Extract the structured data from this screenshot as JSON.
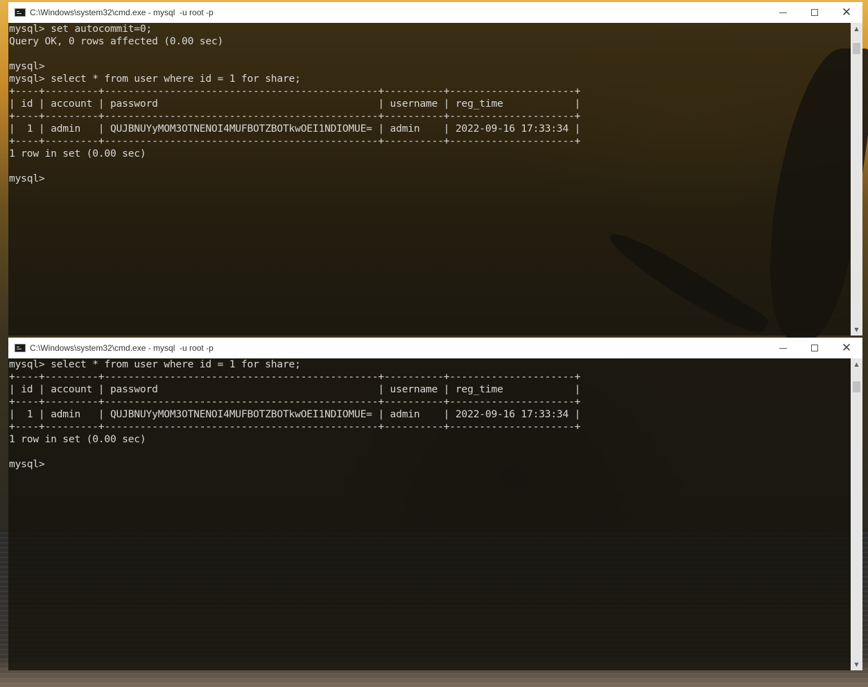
{
  "windows": [
    {
      "title": "C:\\Windows\\system32\\cmd.exe - mysql  -u root -p",
      "lines": [
        "mysql> set autocommit=0;",
        "Query OK, 0 rows affected (0.00 sec)",
        "",
        "mysql>",
        "mysql> select * from user where id = 1 for share;",
        "+----+---------+----------------------------------------------+----------+---------------------+",
        "| id | account | password                                     | username | reg_time            |",
        "+----+---------+----------------------------------------------+----------+---------------------+",
        "|  1 | admin   | QUJBNUYyMOM3OTNENOI4MUFBOTZBOTkwOEI1NDIOMUE= | admin    | 2022-09-16 17:33:34 |",
        "+----+---------+----------------------------------------------+----------+---------------------+",
        "1 row in set (0.00 sec)",
        "",
        "mysql>"
      ]
    },
    {
      "title": "C:\\Windows\\system32\\cmd.exe - mysql  -u root -p",
      "lines": [
        "mysql> select * from user where id = 1 for share;",
        "+----+---------+----------------------------------------------+----------+---------------------+",
        "| id | account | password                                     | username | reg_time            |",
        "+----+---------+----------------------------------------------+----------+---------------------+",
        "|  1 | admin   | QUJBNUYyMOM3OTNENOI4MUFBOTZBOTkwOEI1NDIOMUE= | admin    | 2022-09-16 17:33:34 |",
        "+----+---------+----------------------------------------------+----------+---------------------+",
        "1 row in set (0.00 sec)",
        "",
        "mysql>"
      ]
    }
  ],
  "icons": {
    "app": "cmd-icon",
    "minimize": "minimize-icon",
    "maximize": "maximize-icon",
    "close": "close-icon"
  },
  "colors": {
    "console_text": "#d8d8d8",
    "titlebar": "#ffffff"
  }
}
